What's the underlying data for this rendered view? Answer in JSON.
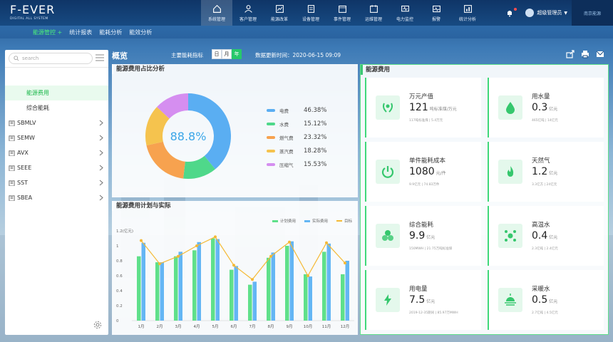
{
  "logo": {
    "title": "F-EVER",
    "subtitle": "DIGITAL ALL SYSTEM"
  },
  "main_nav": [
    {
      "label": "系统管理",
      "icon": "home-icon",
      "active": true
    },
    {
      "label": "客户管理",
      "icon": "users-icon"
    },
    {
      "label": "能源改革",
      "icon": "chart-icon"
    },
    {
      "label": "设备管理",
      "icon": "device-icon"
    },
    {
      "label": "事件管理",
      "icon": "event-icon"
    },
    {
      "label": "运维管理",
      "icon": "calendar-icon"
    },
    {
      "label": "电力监控",
      "icon": "monitor-icon"
    },
    {
      "label": "报警",
      "icon": "alarm-icon"
    },
    {
      "label": "统计分析",
      "icon": "stats-icon"
    }
  ],
  "user": {
    "name": "超级管理员"
  },
  "sub_nav": [
    {
      "label": "能源管控 +",
      "active": true
    },
    {
      "label": "统计报表"
    },
    {
      "label": "能耗分析"
    },
    {
      "label": "能效分析"
    }
  ],
  "sidebar": {
    "search_placeholder": "search",
    "items": [
      {
        "label": "能源费用",
        "sub": true,
        "active": true
      },
      {
        "label": "综合能耗",
        "sub": true
      },
      {
        "label": "SBMLV",
        "expandable": true
      },
      {
        "label": "SEMW",
        "expandable": true
      },
      {
        "label": "AVX",
        "expandable": true
      },
      {
        "label": "SEEE",
        "expandable": true
      },
      {
        "label": "SST",
        "expandable": true
      },
      {
        "label": "SBEA",
        "expandable": true
      }
    ]
  },
  "header": {
    "title": "概览",
    "period_label": "主要能耗指标",
    "periods": [
      {
        "label": "日"
      },
      {
        "label": "月",
        "active": false
      },
      {
        "label": "年",
        "active": true
      }
    ],
    "update_time": "数据更新时间：2020-06-15 09:09"
  },
  "pie_panel": {
    "title": "能源费用占比分析",
    "center_value": "88.8%",
    "slices": [
      {
        "name": "电费",
        "value": 46.38,
        "label": "46.38%",
        "color": "#5aaef2"
      },
      {
        "name": "水费",
        "value": 15.12,
        "label": "15.12%",
        "color": "#4fd88a"
      },
      {
        "name": "燃气费",
        "value": 23.32,
        "label": "23.32%",
        "color": "#f7a24f"
      },
      {
        "name": "蒸汽费",
        "value": 18.28,
        "label": "18.28%",
        "color": "#f5c34e"
      },
      {
        "name": "压缩气",
        "value": 15.53,
        "label": "15.53%",
        "color": "#d58ef0"
      }
    ]
  },
  "bar_panel": {
    "title": "能源费用计划与实际",
    "legend": {
      "plan": "计划费用",
      "actual": "实际费用",
      "target": "目标"
    },
    "colors": {
      "plan": "#5fe08a",
      "actual": "#64b6f4",
      "target": "#f5b935"
    }
  },
  "chart_data": {
    "type": "bar",
    "categories": [
      "1月",
      "2月",
      "3月",
      "4月",
      "5月",
      "6月",
      "7月",
      "8月",
      "9月",
      "10月",
      "11月",
      "12月"
    ],
    "ylabel": "1.2(亿元)",
    "ylim": [
      0,
      1.2
    ],
    "yticks": [
      "1.2(亿元)",
      "1",
      "0.8",
      "0.6",
      "0.4",
      "0.2",
      "0"
    ],
    "series": [
      {
        "name": "计划费用",
        "values": [
          0.86,
          0.78,
          0.86,
          0.94,
          1.1,
          0.68,
          0.48,
          0.84,
          1.0,
          0.62,
          0.92,
          0.62
        ]
      },
      {
        "name": "实际费用",
        "values": [
          1.04,
          0.78,
          0.92,
          1.05,
          1.09,
          0.73,
          0.52,
          0.91,
          1.06,
          0.59,
          1.03,
          0.8
        ]
      },
      {
        "name": "目标",
        "values": [
          1.07,
          0.76,
          0.86,
          1.0,
          1.12,
          0.74,
          0.55,
          0.86,
          1.05,
          0.6,
          1.04,
          0.77
        ]
      }
    ]
  },
  "cost_panel": {
    "title": "能源费用",
    "cards": [
      {
        "title": "万元产值",
        "value": "121",
        "unit": "吨标准煤/万元",
        "meta": "117吨标准煤   |   5.4万元",
        "icon": "laurel-icon"
      },
      {
        "title": "用水量",
        "value": "0.3",
        "unit": "亿元",
        "meta": "465亿吨   |   14亿元",
        "icon": "water-drop-icon"
      },
      {
        "title": "单件能耗成本",
        "value": "1080",
        "unit": "元/件",
        "meta": "9.9亿元   |   74.83万件",
        "icon": "power-icon"
      },
      {
        "title": "天然气",
        "value": "1.2",
        "unit": "亿元",
        "meta": "3.3亿方   |   24亿元",
        "icon": "flame-icon"
      },
      {
        "title": "综合能耗",
        "value": "9.9",
        "unit": "亿元",
        "meta": "150MWH   |   21.75万吨标准煤",
        "icon": "cluster-icon"
      },
      {
        "title": "高温水",
        "value": "0.4",
        "unit": "亿元",
        "meta": "2.3亿吨   |   2.4亿元",
        "icon": "molecule-icon"
      },
      {
        "title": "用电量",
        "value": "7.5",
        "unit": "亿元",
        "meta": "2019-12-35期间   |   85.97万MWH",
        "icon": "lightning-icon"
      },
      {
        "title": "采暖水",
        "value": "0.5",
        "unit": "亿元",
        "meta": "2.7亿吨   |   4.5亿元",
        "icon": "sunrise-icon"
      }
    ]
  },
  "brand_badge": "南京能源"
}
